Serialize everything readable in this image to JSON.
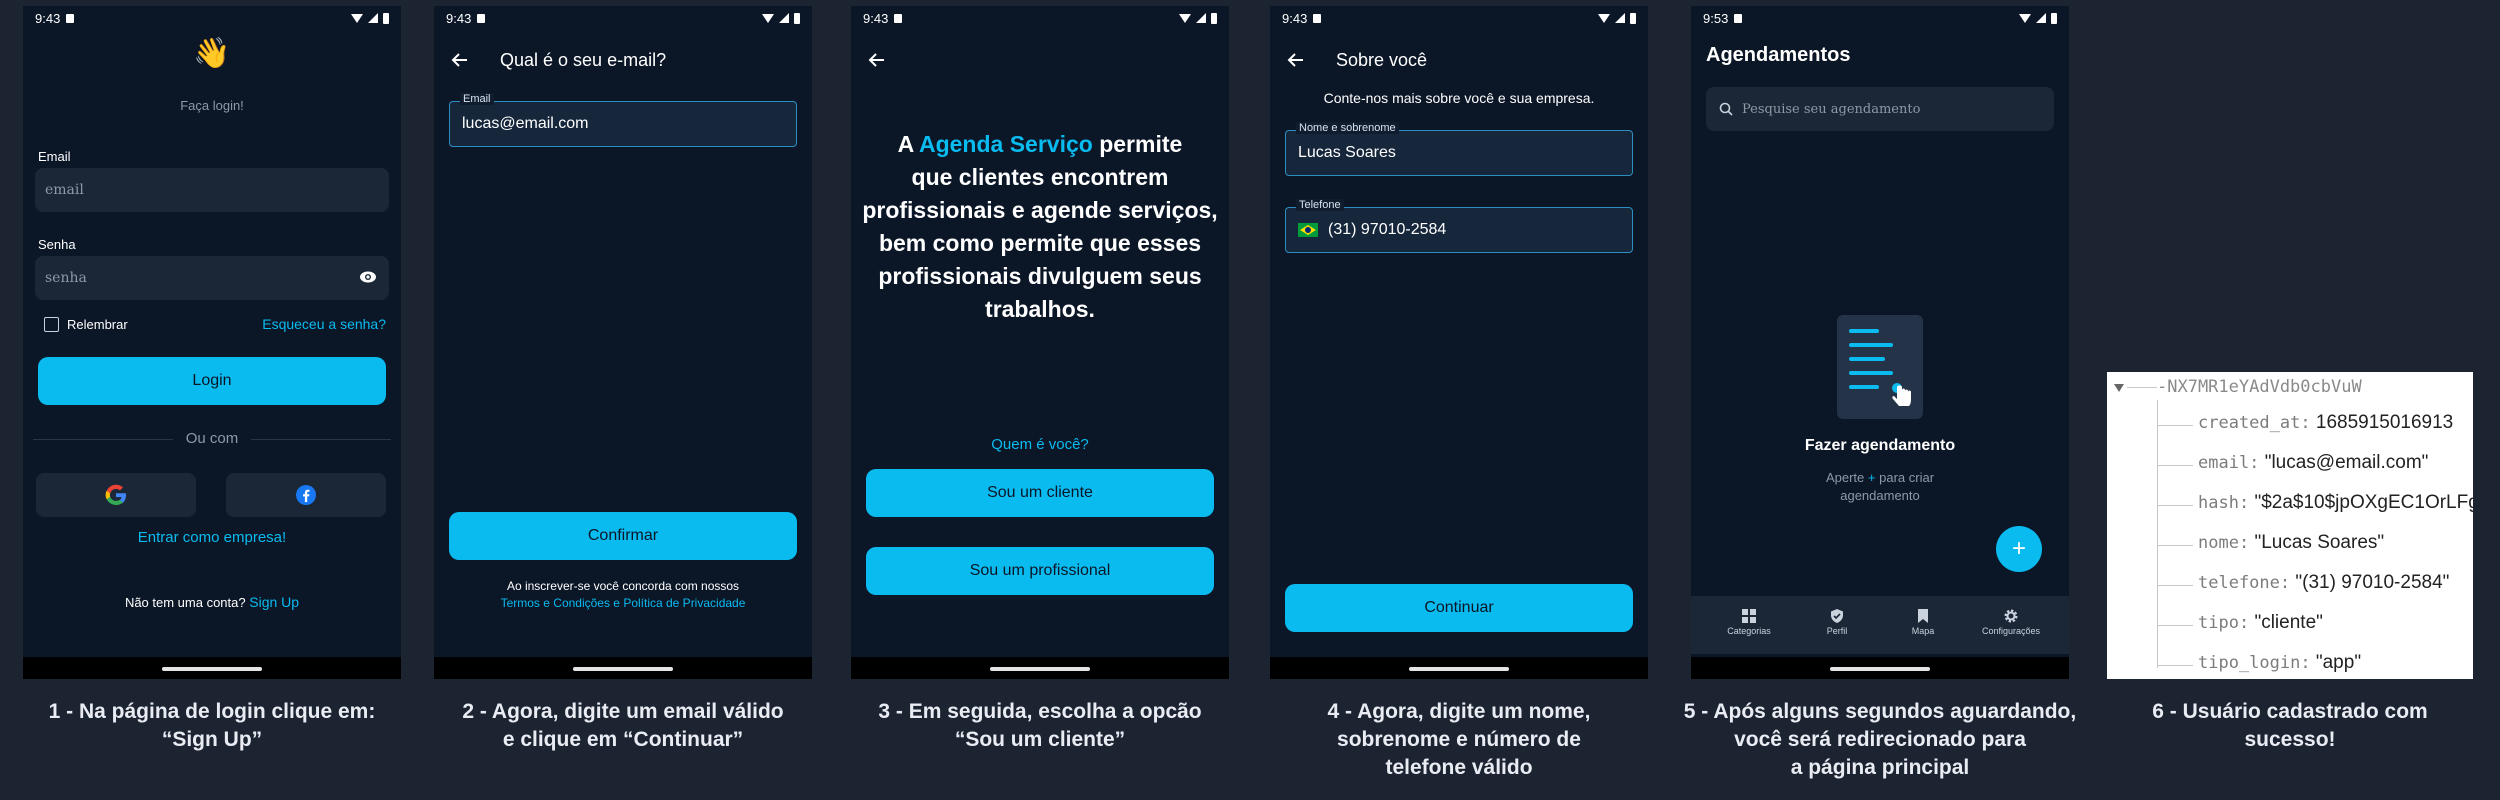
{
  "status_time": "9:43",
  "status_time_5": "9:53",
  "screen1": {
    "tagline": "Faça login!",
    "email_label": "Email",
    "email_placeholder": "email",
    "password_label": "Senha",
    "password_placeholder": "senha",
    "remember_label": "Relembrar",
    "forgot_link": "Esqueceu a senha?",
    "login_button": "Login",
    "divider_text": "Ou com",
    "enterprise_link": "Entrar como empresa!",
    "no_account_text": "Não tem uma conta?",
    "signup_link": "Sign Up"
  },
  "screen2": {
    "title": "Qual é o seu e-mail?",
    "email_label": "Email",
    "email_value": "lucas@email.com",
    "confirm_button": "Confirmar",
    "terms_text": "Ao inscrever-se você concorda com nossos",
    "terms_link": "Termos e Condições e Política de Privacidade"
  },
  "screen3": {
    "intro_a": "A",
    "brand": "Agenda Serviço",
    "intro_rest_line1": "permite",
    "line2": "que clientes encontrem",
    "line3": "profissionais e agende serviços,",
    "line4": "bem como permite que esses",
    "line5": "profissionais divulguem seus",
    "line6": "trabalhos.",
    "question": "Quem é você?",
    "client_button": "Sou um cliente",
    "pro_button": "Sou um profissional"
  },
  "screen4": {
    "title": "Sobre você",
    "subtitle": "Conte-nos mais sobre você e sua empresa.",
    "name_label": "Nome e sobrenome",
    "name_value": "Lucas Soares",
    "phone_label": "Telefone",
    "phone_value": "(31) 97010-2584",
    "continue_button": "Continuar"
  },
  "screen5": {
    "title": "Agendamentos",
    "search_placeholder": "Pesquise seu agendamento",
    "empty_title": "Fazer agendamento",
    "empty_hint_a": "Aperte",
    "empty_hint_plus": "+",
    "empty_hint_b": "para criar",
    "empty_hint_c": "agendamento",
    "fab": "+",
    "nav": [
      {
        "label": "Categorias",
        "icon": "grid-icon"
      },
      {
        "label": "Perfil",
        "icon": "shield-check-icon"
      },
      {
        "label": "Mapa",
        "icon": "bookmark-icon"
      },
      {
        "label": "Configurações",
        "icon": "gear-icon"
      }
    ]
  },
  "screen6": {
    "root_key": "-NX7MR1eYAdVdb0cbVuW",
    "fields": [
      {
        "key": "created_at:",
        "value": "1685915016913"
      },
      {
        "key": "email:",
        "value": "\"lucas@email.com\""
      },
      {
        "key": "hash:",
        "value": "\"$2a$10$jpOXgEC1OrLFg"
      },
      {
        "key": "nome:",
        "value": "\"Lucas Soares\""
      },
      {
        "key": "telefone:",
        "value": "\"(31) 97010-2584\""
      },
      {
        "key": "tipo:",
        "value": "\"cliente\""
      },
      {
        "key": "tipo_login:",
        "value": "\"app\""
      }
    ]
  },
  "captions": {
    "c1_l1": "1 - Na página de login clique em:",
    "c1_l2": "“Sign Up”",
    "c2_l1": "2 - Agora, digite um email válido",
    "c2_l2": "e clique em “Continuar”",
    "c3_l1": "3 - Em seguida, escolha a opcão",
    "c3_l2": "“Sou um cliente”",
    "c4_l1": "4 - Agora, digite um nome,",
    "c4_l2": "sobrenome e número de",
    "c4_l3": "telefone válido",
    "c5_l1": "5 - Após alguns segundos aguardando,",
    "c5_l2": "você será redirecionado para",
    "c5_l3": "a página principal",
    "c6_l1": "6 - Usuário cadastrado com",
    "c6_l2": "sucesso!"
  },
  "colors": {
    "background": "#1c2331",
    "phone_bg": "#0b1627",
    "accent": "#0abbf0",
    "field_bg": "#1b2636"
  }
}
